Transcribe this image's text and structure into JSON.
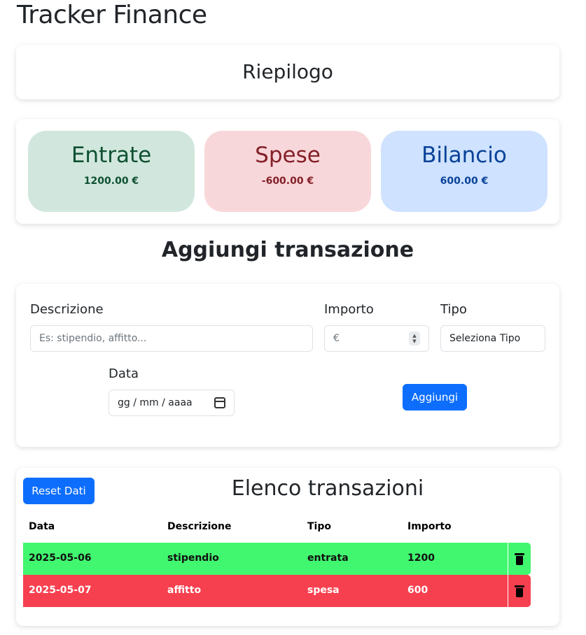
{
  "app": {
    "title": "Tracker Finance"
  },
  "riepilogo": {
    "title": "Riepilogo"
  },
  "summary": {
    "entrate": {
      "label": "Entrate",
      "value": "1200.00 €"
    },
    "spese": {
      "label": "Spese",
      "value": "-600.00 €"
    },
    "bilancio": {
      "label": "Bilancio",
      "value": "600.00 €"
    }
  },
  "form": {
    "title": "Aggiungi transazione",
    "descrizione_label": "Descrizione",
    "descrizione_placeholder": "Es: stipendio, affitto...",
    "importo_label": "Importo",
    "importo_placeholder": "€",
    "tipo_label": "Tipo",
    "tipo_selected": "Seleziona Tipo",
    "data_label": "Data",
    "data_placeholder": "gg / mm / aaaa",
    "submit_label": "Aggiungi"
  },
  "list": {
    "reset_label": "Reset Dati",
    "title": "Elenco transazioni",
    "columns": [
      "Data",
      "Descrizione",
      "Tipo",
      "Importo"
    ],
    "rows": [
      {
        "data": "2025-05-06",
        "descrizione": "stipendio",
        "tipo": "entrata",
        "importo": "1200"
      },
      {
        "data": "2025-05-07",
        "descrizione": "affitto",
        "tipo": "spesa",
        "importo": "600"
      }
    ],
    "delete_icon": "trash-icon"
  },
  "colors": {
    "primary": "#0d6efd",
    "entrata_row": "#41f76f",
    "spesa_row": "#f7404f",
    "entrate_bg": "#d1e7dd",
    "spese_bg": "#f8d7da",
    "bilancio_bg": "#cfe2ff"
  }
}
